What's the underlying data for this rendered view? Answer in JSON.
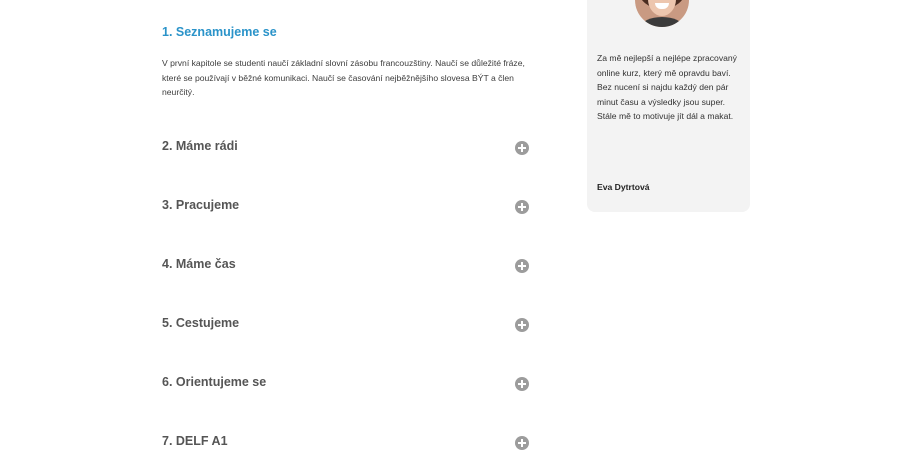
{
  "chapters": {
    "open": {
      "title": "1. Seznamujeme se",
      "description": "V první kapitole se studenti naučí základní slovní zásobu francouzštiny. Naučí se důležité fráze, které se používají v běžné komunikaci. Naučí se časování nejběžnějšího slovesa BÝT a člen neurčitý."
    },
    "items": [
      {
        "title": "2. Máme rádi",
        "icon": "plus-circle-icon"
      },
      {
        "title": "3. Pracujeme",
        "icon": "plus-circle-icon"
      },
      {
        "title": "4. Máme čas",
        "icon": "plus-circle-icon"
      },
      {
        "title": "5. Cestujeme",
        "icon": "plus-circle-icon"
      },
      {
        "title": "6. Orientujeme se",
        "icon": "plus-circle-icon"
      },
      {
        "title": "7. DELF A1",
        "icon": "plus-circle-icon"
      }
    ]
  },
  "testimonial": {
    "quote": "Za mě nejlepší a nejlépe zpracovaný online kurz, který mě opravdu baví. Bez nucení si najdu každý den pár minut času a výsledky jsou super. Stále mě to motivuje jít dál a makat.",
    "author": "Eva Dytrtová"
  },
  "colors": {
    "accent": "#2a93c9",
    "chapter_title": "#555555",
    "icon": "#9c9c9c",
    "card_background": "#f3f3f3"
  }
}
